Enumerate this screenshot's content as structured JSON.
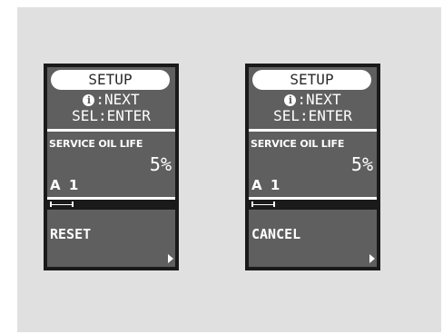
{
  "screens": [
    {
      "header": "SETUP",
      "info_text": ":NEXT",
      "sel_text": "SEL:ENTER",
      "service_label": "SERVICE OIL LIFE",
      "percent": "5%",
      "trip_label": "A 1",
      "action_label": "RESET"
    },
    {
      "header": "SETUP",
      "info_text": ":NEXT",
      "sel_text": "SEL:ENTER",
      "service_label": "SERVICE OIL LIFE",
      "percent": "5%",
      "trip_label": "A 1",
      "action_label": "CANCEL"
    }
  ],
  "icons": {
    "info": "info-icon",
    "arrow": "right-arrow-icon"
  },
  "info_glyph": "i"
}
